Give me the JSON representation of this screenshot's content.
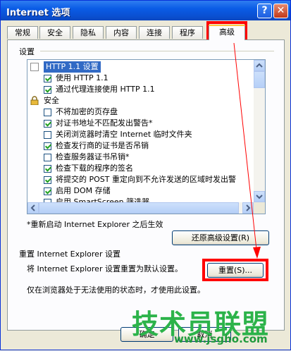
{
  "window": {
    "title": "Internet 选项",
    "help_label": "?",
    "close_label": "✕"
  },
  "tabs": [
    {
      "label": "常规"
    },
    {
      "label": "安全"
    },
    {
      "label": "隐私"
    },
    {
      "label": "内容"
    },
    {
      "label": "连接"
    },
    {
      "label": "程序"
    },
    {
      "label": "高级"
    }
  ],
  "settings": {
    "group_label": "设置",
    "items": [
      {
        "label": "HTTP 1.1 设置",
        "type": "category",
        "selected": true
      },
      {
        "label": "使用 HTTP 1.1",
        "type": "checkbox",
        "checked": true
      },
      {
        "label": "通过代理连接使用 HTTP 1.1",
        "type": "checkbox",
        "checked": true
      },
      {
        "label": "安全",
        "type": "category-lock"
      },
      {
        "label": "不将加密的页存盘",
        "type": "checkbox",
        "checked": false
      },
      {
        "label": "对证书地址不匹配发出警告*",
        "type": "checkbox",
        "checked": true
      },
      {
        "label": "关闭浏览器时清空 Internet 临时文件夹",
        "type": "checkbox",
        "checked": false
      },
      {
        "label": "检查发行商的证书是否吊销",
        "type": "checkbox",
        "checked": true
      },
      {
        "label": "检查服务器证书吊销*",
        "type": "checkbox",
        "checked": false
      },
      {
        "label": "检查下载的程序的签名",
        "type": "checkbox",
        "checked": true
      },
      {
        "label": "将提交的 POST 重定向到不允许发送的区域时发出警",
        "type": "checkbox",
        "checked": true
      },
      {
        "label": "启用 DOM 存储",
        "type": "checkbox",
        "checked": true
      },
      {
        "label": "启用 SmartScreen 筛选器",
        "type": "checkbox",
        "checked": false
      }
    ],
    "restart_note": "*重新启动 Internet Explorer 之后生效",
    "restore_button": "还原高级设置(R)"
  },
  "reset": {
    "group_label": "重置 Internet Explorer 设置",
    "description": "将 Internet Explorer 设置重置为默认设置。",
    "reset_button": "重置(S)...",
    "note": "仅在浏览器处于无法使用的状态时，才使用此设置。"
  },
  "footer": {
    "ok_button": "确定",
    "cancel_button": "取消"
  },
  "watermark": {
    "title": "技术员联盟",
    "url": "www.jsgho.com"
  },
  "annotation_color": "#ff0000"
}
